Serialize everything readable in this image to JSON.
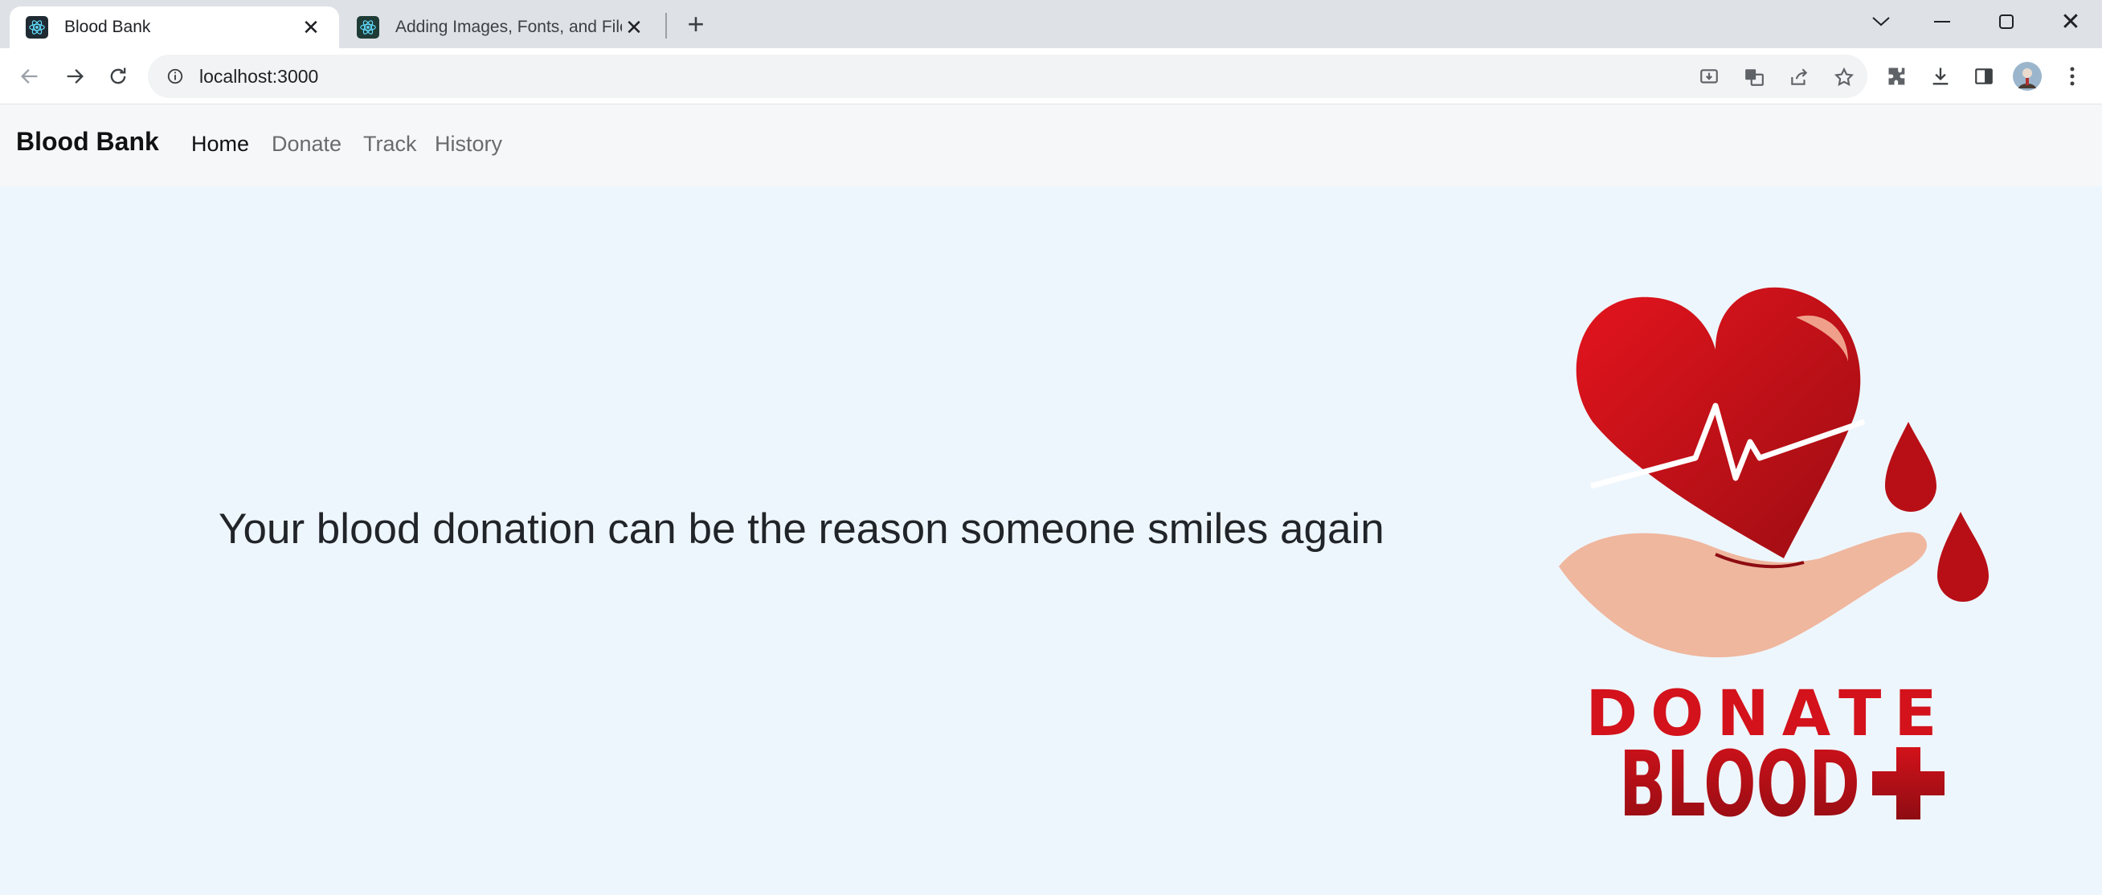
{
  "browser": {
    "tabs": [
      {
        "title": "Blood Bank",
        "active": true
      },
      {
        "title": "Adding Images, Fonts, and Files",
        "active": false
      }
    ],
    "url": "localhost:3000"
  },
  "app": {
    "brand": "Blood Bank",
    "nav": [
      {
        "label": "Home",
        "active": true
      },
      {
        "label": "Donate",
        "active": false
      },
      {
        "label": "Track",
        "active": false
      },
      {
        "label": "History",
        "active": false
      }
    ],
    "hero_text": "Your blood donation can be the reason someone smiles again",
    "logo": {
      "line1": "DONATE",
      "line2": "BLOOD"
    }
  },
  "colors": {
    "accent_red": "#d3121b",
    "dark_red": "#8e0c12",
    "hand": "#efb79e",
    "page_bg": "#eef6fd"
  },
  "icons": [
    "react-icon",
    "close-icon",
    "new-tab-icon",
    "chevron-down-icon",
    "minimize-icon",
    "restore-icon",
    "back-icon",
    "forward-icon",
    "reload-icon",
    "info-icon",
    "install-icon",
    "translate-icon",
    "share-icon",
    "star-icon",
    "extensions-icon",
    "download-icon",
    "side-panel-icon",
    "avatar",
    "menu-icon"
  ]
}
